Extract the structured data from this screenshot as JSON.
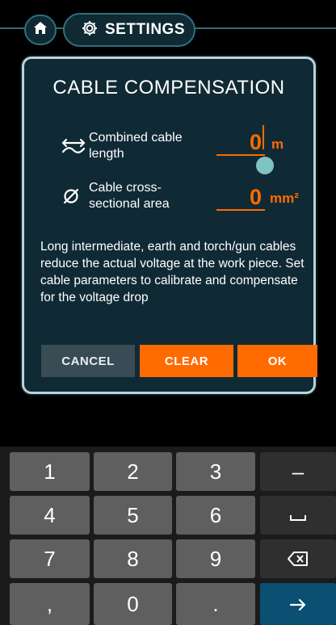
{
  "topbar": {
    "home_icon": "home-icon",
    "settings_icon": "gear-icon",
    "settings_label": "SETTINGS"
  },
  "dialog": {
    "title": "CABLE COMPENSATION",
    "length": {
      "icon": "cable-length-icon",
      "label": "Combined cable length",
      "value": "0",
      "unit": "m"
    },
    "area": {
      "icon": "diameter-icon",
      "label": "Cable cross-sectional area",
      "value": "0",
      "unit": "mm²"
    },
    "description": "Long intermediate, earth and torch/gun cables reduce the actual voltage at the work piece. Set cable parameters to calibrate and compensate for the voltage drop",
    "buttons": {
      "cancel": "CANCEL",
      "clear": "CLEAR",
      "ok": "OK"
    }
  },
  "keypad": {
    "keys": [
      [
        "1",
        "2",
        "3",
        "–"
      ],
      [
        "4",
        "5",
        "6",
        "␣"
      ],
      [
        "7",
        "8",
        "9",
        "⌫"
      ],
      [
        ",",
        "0",
        ".",
        "→"
      ]
    ],
    "icons": {
      "space": "space-icon",
      "backspace": "backspace-icon",
      "enter": "arrow-right-icon"
    }
  },
  "colors": {
    "accent": "#ff6b00",
    "dialog_bg": "#102a35",
    "dialog_border": "#b9d3d8",
    "enter_key": "#0b4f73"
  }
}
